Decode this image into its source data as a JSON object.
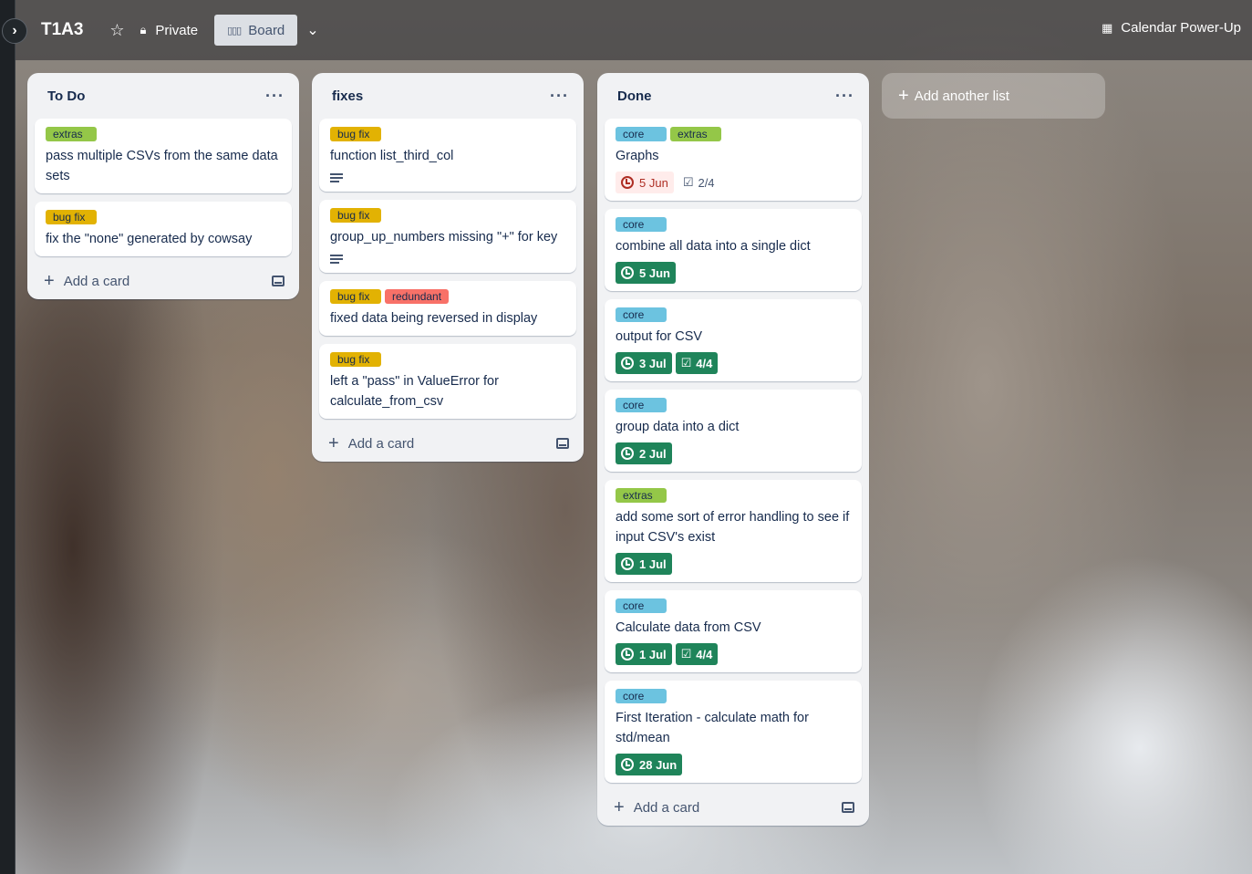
{
  "header": {
    "board_title": "T1A3",
    "star_icon": "star-icon",
    "visibility": "Private",
    "view_label": "Board",
    "calendar_label": "Calendar Power-Up"
  },
  "label_colors": {
    "extras": "#94c748",
    "bug fix": "#e2b203",
    "core": "#6cc3e0",
    "redundant": "#f87168"
  },
  "lists": [
    {
      "title": "To Do",
      "cards": [
        {
          "labels": [
            "extras"
          ],
          "title": "pass multiple CSVs from the same data sets"
        },
        {
          "labels": [
            "bug fix"
          ],
          "title": "fix the \"none\" generated by cowsay"
        }
      ],
      "add_card": "Add a card"
    },
    {
      "title": "fixes",
      "cards": [
        {
          "labels": [
            "bug fix"
          ],
          "title": "function list_third_col",
          "description": true
        },
        {
          "labels": [
            "bug fix"
          ],
          "title": "group_up_numbers missing \"+\" for key",
          "description": true
        },
        {
          "labels": [
            "bug fix",
            "redundant"
          ],
          "title": "fixed data being reversed in display"
        },
        {
          "labels": [
            "bug fix"
          ],
          "title": "left a \"pass\" in ValueError for calculate_from_csv"
        }
      ],
      "add_card": "Add a card"
    },
    {
      "title": "Done",
      "cards": [
        {
          "labels": [
            "core",
            "extras"
          ],
          "title": "Graphs",
          "due": "5 Jun",
          "due_status": "overdue",
          "checklist": "2/4",
          "checklist_status": "plain"
        },
        {
          "labels": [
            "core"
          ],
          "title": "combine all data into a single dict",
          "due": "5 Jun",
          "due_status": "done"
        },
        {
          "labels": [
            "core"
          ],
          "title": "output for CSV",
          "due": "3 Jul",
          "due_status": "done",
          "checklist": "4/4",
          "checklist_status": "done"
        },
        {
          "labels": [
            "core"
          ],
          "title": "group data into a dict",
          "due": "2 Jul",
          "due_status": "done"
        },
        {
          "labels": [
            "extras"
          ],
          "title": "add some sort of error handling to see if input CSV's exist",
          "due": "1 Jul",
          "due_status": "done"
        },
        {
          "labels": [
            "core"
          ],
          "title": "Calculate data from CSV",
          "due": "1 Jul",
          "due_status": "done",
          "checklist": "4/4",
          "checklist_status": "done"
        },
        {
          "labels": [
            "core"
          ],
          "title": "First Iteration - calculate math for std/mean",
          "due": "28 Jun",
          "due_status": "done"
        }
      ],
      "add_card": "Add a card"
    }
  ],
  "add_list": "Add another list"
}
